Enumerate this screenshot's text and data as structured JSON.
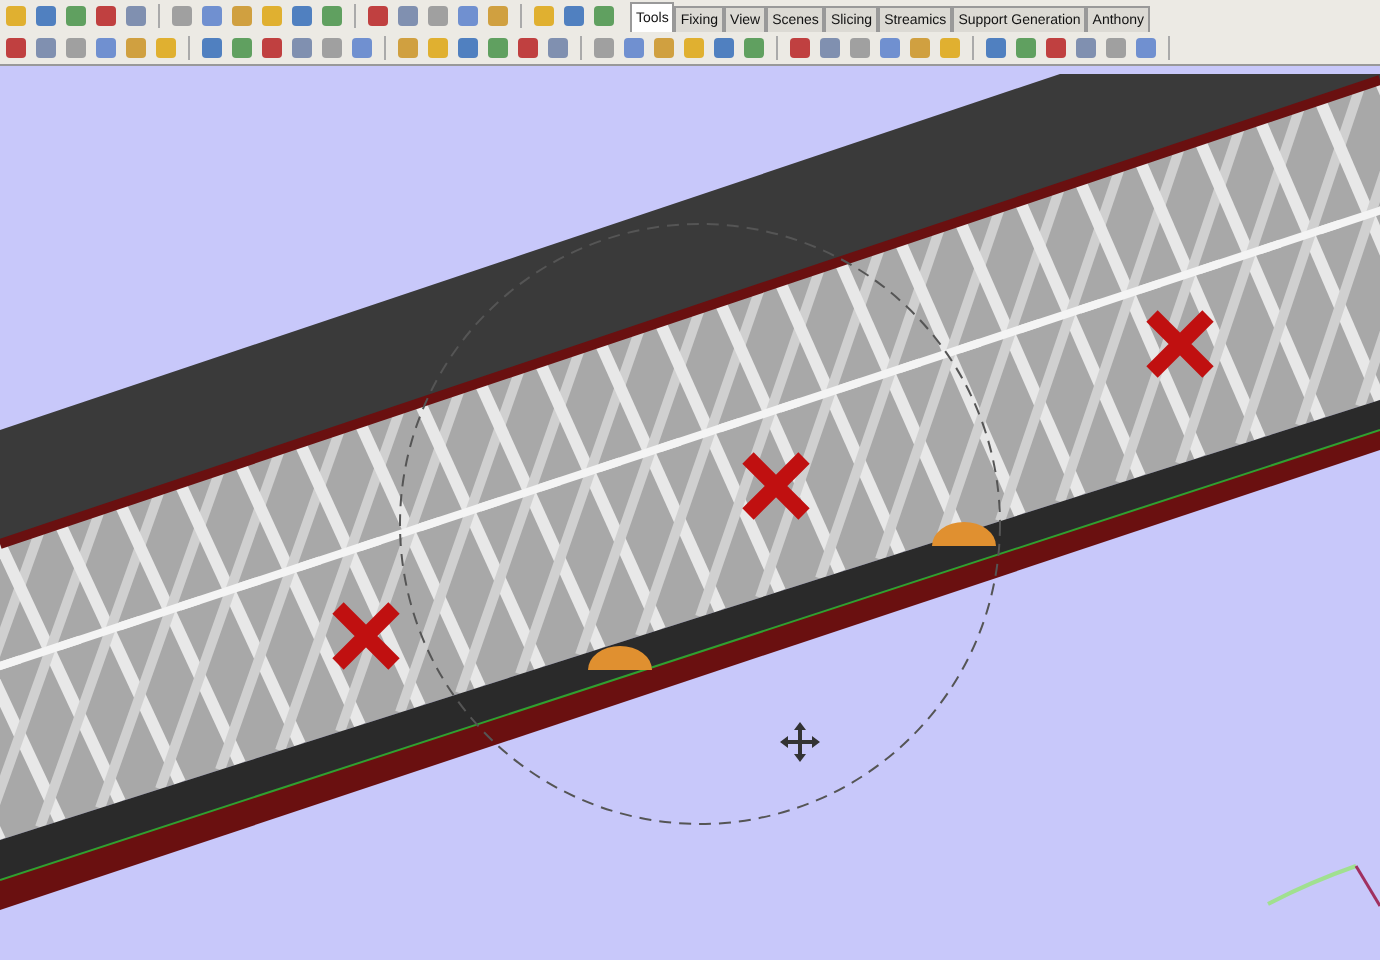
{
  "ribbon_tabs": [
    {
      "label": "Tools",
      "selected": true
    },
    {
      "label": "Fixing",
      "selected": false
    },
    {
      "label": "View",
      "selected": false
    },
    {
      "label": "Scenes",
      "selected": false
    },
    {
      "label": "Slicing",
      "selected": false
    },
    {
      "label": "Streamics",
      "selected": false
    },
    {
      "label": "Support Generation",
      "selected": false
    },
    {
      "label": "Anthony",
      "selected": false
    }
  ]
}
